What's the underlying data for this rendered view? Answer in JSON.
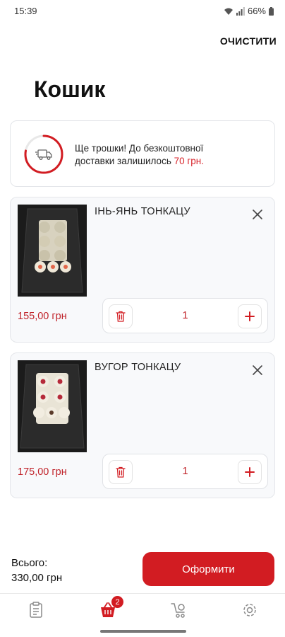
{
  "status_bar": {
    "time": "15:39",
    "battery": "66%"
  },
  "header": {
    "clear_label": "ОЧИСТИТИ",
    "title": "Кошик"
  },
  "delivery": {
    "text_line1": "Ще трошки! До безкоштовної",
    "text_line2_prefix": "доставки залишилось ",
    "amount": "70 грн.",
    "progress_fraction": 0.78
  },
  "cart_items": [
    {
      "name": "ІНЬ-ЯНЬ ТОНКАЦУ",
      "price": "155,00 грн",
      "quantity": "1"
    },
    {
      "name": "ВУГОР ТОНКАЦУ",
      "price": "175,00 грн",
      "quantity": "1"
    }
  ],
  "footer": {
    "total_label": "Всього:",
    "total_value": "330,00 грн",
    "checkout_label": "Оформити"
  },
  "bottom_nav": {
    "items": [
      "menu-icon",
      "cart-icon",
      "delivery-icon",
      "settings-icon"
    ],
    "cart_badge": "2"
  },
  "colors": {
    "accent": "#d21c22",
    "price": "#c0232a"
  }
}
